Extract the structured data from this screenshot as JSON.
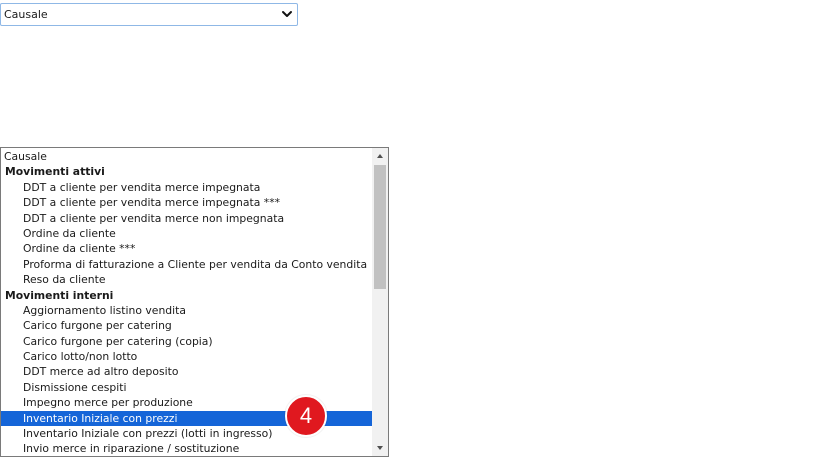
{
  "select": {
    "value": "Causale"
  },
  "listbox": {
    "rows": [
      {
        "label": "Causale",
        "kind": "option"
      },
      {
        "label": "Movimenti attivi",
        "kind": "group"
      },
      {
        "label": "DDT a cliente per vendita merce impegnata",
        "kind": "indent"
      },
      {
        "label": "DDT a cliente per vendita merce impegnata ***",
        "kind": "indent"
      },
      {
        "label": "DDT a cliente per vendita merce non impegnata",
        "kind": "indent"
      },
      {
        "label": "Ordine da cliente",
        "kind": "indent"
      },
      {
        "label": "Ordine da cliente ***",
        "kind": "indent"
      },
      {
        "label": "Proforma di fatturazione a Cliente per vendita da Conto vendita",
        "kind": "indent"
      },
      {
        "label": "Reso da cliente",
        "kind": "indent"
      },
      {
        "label": "Movimenti interni",
        "kind": "group"
      },
      {
        "label": "Aggiornamento listino vendita",
        "kind": "indent"
      },
      {
        "label": "Carico furgone per catering",
        "kind": "indent"
      },
      {
        "label": "Carico furgone per catering (copia)",
        "kind": "indent"
      },
      {
        "label": "Carico lotto/non lotto",
        "kind": "indent"
      },
      {
        "label": "DDT merce ad altro deposito",
        "kind": "indent"
      },
      {
        "label": "Dismissione cespiti",
        "kind": "indent"
      },
      {
        "label": "Impegno merce per produzione",
        "kind": "indent"
      },
      {
        "label": "Inventario Iniziale con prezzi",
        "kind": "indent",
        "selected": true
      },
      {
        "label": "Inventario Iniziale con prezzi (lotti in ingresso)",
        "kind": "indent"
      },
      {
        "label": "Invio merce in riparazione / sostituzione",
        "kind": "indent"
      }
    ]
  },
  "badge": {
    "label": "4",
    "color": "#e0181f"
  },
  "colors": {
    "selection": "#1565d8",
    "select_border": "#8fb8e6"
  }
}
